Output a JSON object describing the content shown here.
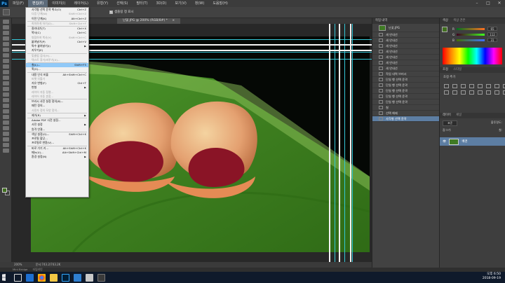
{
  "app": {
    "logo": "Ps"
  },
  "menu": {
    "items": [
      "파일(F)",
      "편집(E)",
      "이미지(I)",
      "레이어(L)",
      "유형(Y)",
      "선택(S)",
      "필터(T)",
      "3D(D)",
      "보기(V)",
      "창(W)",
      "도움말(H)"
    ],
    "active_index": 1
  },
  "options_bar": {
    "checkbox_label": "샘플링 정 표시"
  },
  "document": {
    "tab_title": "난꽃.JPG @ 200% (RGB/8#) *",
    "zoom": "200%",
    "doc_info": "문서:743.2/743.2K"
  },
  "edit_menu": [
    {
      "label": "사각형 선택 윤곽 취소(O)",
      "shortcut": "Ctrl+Z",
      "disabled": false
    },
    {
      "label": "다음 단계(W)",
      "shortcut": "Shift+Ctrl+Z",
      "disabled": true
    },
    {
      "label": "이전 단계(K)",
      "shortcut": "Alt+Ctrl+Z",
      "disabled": false
    },
    {
      "sep": true
    },
    {
      "label": "희미하게 하기(D)...",
      "shortcut": "Shift+Ctrl+F",
      "disabled": true
    },
    {
      "sep": true
    },
    {
      "label": "잘라내기(T)",
      "shortcut": "Ctrl+X",
      "disabled": false
    },
    {
      "label": "복사(C)",
      "shortcut": "Ctrl+C",
      "disabled": false
    },
    {
      "label": "병합하여 복사(Y)",
      "shortcut": "Shift+Ctrl+C",
      "disabled": true
    },
    {
      "label": "붙여넣기(P)",
      "shortcut": "Ctrl+V",
      "disabled": false
    },
    {
      "label": "특수 붙여넣기(I)",
      "shortcut": "",
      "arrow": true,
      "disabled": false
    },
    {
      "label": "지우기(E)",
      "shortcut": "",
      "disabled": false
    },
    {
      "sep": true
    },
    {
      "label": "맞춤법 검사(H)...",
      "shortcut": "",
      "disabled": true
    },
    {
      "label": "텍스트 찾기/바꾸기(X)...",
      "shortcut": "",
      "disabled": true
    },
    {
      "sep": true
    },
    {
      "label": "칠(L)...",
      "shortcut": "Shift+F5",
      "highlight": true,
      "disabled": false
    },
    {
      "label": "획(S)...",
      "shortcut": "",
      "disabled": false
    },
    {
      "sep": true
    },
    {
      "label": "내용 인식 비율",
      "shortcut": "Alt+Shift+Ctrl+C",
      "disabled": false
    },
    {
      "label": "퍼펫 뒤틀기",
      "shortcut": "",
      "disabled": true
    },
    {
      "label": "자유 변형(F)",
      "shortcut": "Ctrl+T",
      "disabled": false
    },
    {
      "label": "변형",
      "shortcut": "",
      "arrow": true,
      "disabled": false
    },
    {
      "label": "레이어 자동 정렬...",
      "shortcut": "",
      "disabled": true
    },
    {
      "label": "레이어 자동 혼합...",
      "shortcut": "",
      "disabled": true
    },
    {
      "sep": true
    },
    {
      "label": "브러시 사전 설정 정의(B)...",
      "shortcut": "",
      "disabled": false
    },
    {
      "label": "패턴 정의...",
      "shortcut": "",
      "disabled": false
    },
    {
      "label": "사용자 정의 모양 정의...",
      "shortcut": "",
      "disabled": true
    },
    {
      "sep": true
    },
    {
      "label": "제거(R)",
      "shortcut": "",
      "arrow": true,
      "disabled": false
    },
    {
      "sep": true
    },
    {
      "label": "Adobe PDF 사전 설정...",
      "shortcut": "",
      "disabled": false
    },
    {
      "label": "사전 설정",
      "shortcut": "",
      "arrow": true,
      "disabled": false
    },
    {
      "label": "원격 연결...",
      "shortcut": "",
      "disabled": false
    },
    {
      "sep": true
    },
    {
      "label": "색상 설정(G)...",
      "shortcut": "Shift+Ctrl+K",
      "disabled": false
    },
    {
      "label": "프로필 할당...",
      "shortcut": "",
      "disabled": false
    },
    {
      "label": "프로필로 변환(V)...",
      "shortcut": "",
      "disabled": false
    },
    {
      "sep": true
    },
    {
      "label": "바로 가기 키...",
      "shortcut": "Alt+Shift+Ctrl+K",
      "disabled": false
    },
    {
      "label": "메뉴(U)...",
      "shortcut": "Alt+Shift+Ctrl+M",
      "disabled": false
    },
    {
      "label": "환경 설정(N)",
      "shortcut": "",
      "arrow": true,
      "disabled": false
    }
  ],
  "history": {
    "tab_label": "작업 내역",
    "snapshot": "난꽃.JPG",
    "items": [
      "새 안내선",
      "새 안내선",
      "새 안내선",
      "새 안내선",
      "새 안내선",
      "새 안내선",
      "새 안내선",
      "작업 내역 브러시",
      "단일 행 선택 윤곽",
      "단일 행 선택 윤곽",
      "단일 행 선택 윤곽",
      "단일 행 선택 윤곽",
      "단일 행 선택 윤곽",
      "칠",
      "선택 해제",
      "사각형 선택 윤곽"
    ],
    "selected_index": 15
  },
  "color_panel": {
    "tab_label": "색상",
    "tab2_label": "색상 견본",
    "r": "65",
    "g": "112",
    "b": "31"
  },
  "adjustments_panel": {
    "tab_label": "조정",
    "tab2_label": "스타일",
    "title": "조정 추가"
  },
  "layers_panel": {
    "tab_label": "레이어",
    "tab2_label": "채널",
    "blend_mode": "표준",
    "opacity_label": "불투명도:",
    "lock_label": "잠그기:",
    "fill_label": "칠:",
    "layer_name": "배경"
  },
  "status": {
    "mini_bridge": "Mini Bridge",
    "timeline": "타임라인"
  },
  "taskbar": {
    "time": "오후 6:50",
    "date": "2018-09-19"
  },
  "colors": {
    "accent": "#5d7ea3",
    "fg": "#41701f",
    "bg": "#ffffff",
    "highlight": "#91c9f7"
  }
}
